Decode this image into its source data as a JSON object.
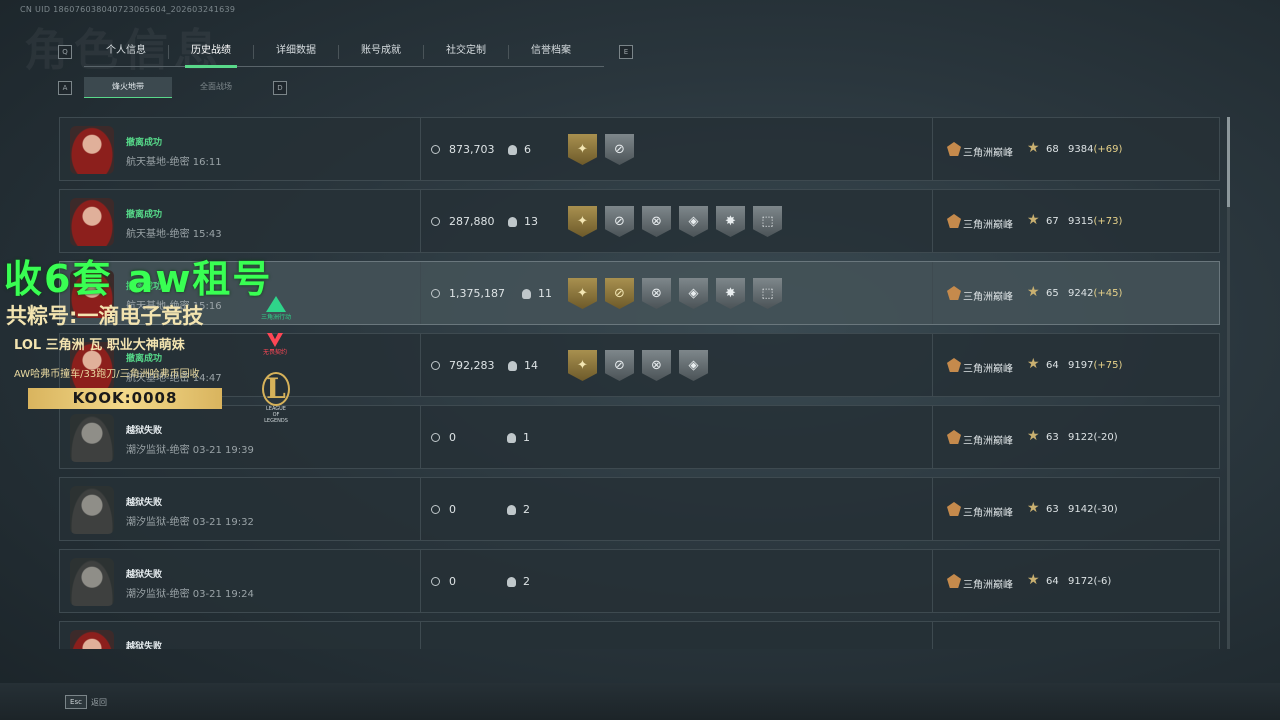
{
  "uid": "CN UID 1860760380407230656​04_202603241639",
  "bg_title": "角色信息",
  "key_hints": {
    "left_tab": "Q",
    "right_tab": "E",
    "left_sub": "A",
    "right_sub": "D"
  },
  "tabs": [
    {
      "label": "个人信息",
      "active": false
    },
    {
      "label": "历史战绩",
      "active": true
    },
    {
      "label": "详细数据",
      "active": false
    },
    {
      "label": "账号成就",
      "active": false
    },
    {
      "label": "社交定制",
      "active": false
    },
    {
      "label": "信誉档案",
      "active": false
    }
  ],
  "subtabs": [
    {
      "label": "烽火地带",
      "active": true
    },
    {
      "label": "全面战场",
      "active": false
    }
  ],
  "rows": [
    {
      "avatar": "female-operator",
      "status": "撤离成功",
      "status_type": "ok",
      "location": "航天基地-绝密 16:11",
      "value": "873,703",
      "kills": "6",
      "badges": [
        "gold",
        "grey"
      ],
      "rank_name": "三角洲巅峰",
      "level": "68",
      "score": "9384",
      "delta": "(+69)",
      "delta_type": "pos",
      "highlight": false
    },
    {
      "avatar": "female-operator",
      "status": "撤离成功",
      "status_type": "ok",
      "location": "航天基地-绝密 15:43",
      "value": "287,880",
      "kills": "13",
      "badges": [
        "gold",
        "grey",
        "grey",
        "grey",
        "grey",
        "grey"
      ],
      "rank_name": "三角洲巅峰",
      "level": "67",
      "score": "9315",
      "delta": "(+73)",
      "delta_type": "pos",
      "highlight": false
    },
    {
      "avatar": "female-operator",
      "status": "撤离成功",
      "status_type": "ok",
      "location": "航天基地-绝密 15:16",
      "value": "1,375,187",
      "kills": "11",
      "badges": [
        "gold",
        "gold",
        "grey",
        "grey",
        "grey",
        "grey"
      ],
      "rank_name": "三角洲巅峰",
      "level": "65",
      "score": "9242",
      "delta": "(+45)",
      "delta_type": "pos",
      "highlight": true
    },
    {
      "avatar": "female-operator",
      "status": "撤离成功",
      "status_type": "ok",
      "location": "航天基地-绝密 14:47",
      "value": "792,283",
      "kills": "14",
      "badges": [
        "gold",
        "grey",
        "grey",
        "grey"
      ],
      "rank_name": "三角洲巅峰",
      "level": "64",
      "score": "9197",
      "delta": "(+75)",
      "delta_type": "pos",
      "highlight": false
    },
    {
      "avatar": "male-operator",
      "status": "越狱失败",
      "status_type": "fail",
      "location": "潮汐监狱-绝密 03-21 19:39",
      "value": "0",
      "kills": "1",
      "badges": [],
      "rank_name": "三角洲巅峰",
      "level": "63",
      "score": "9122",
      "delta": "(-20)",
      "delta_type": "neg",
      "highlight": false
    },
    {
      "avatar": "male-operator",
      "status": "越狱失败",
      "status_type": "fail",
      "location": "潮汐监狱-绝密 03-21 19:32",
      "value": "0",
      "kills": "2",
      "badges": [],
      "rank_name": "三角洲巅峰",
      "level": "63",
      "score": "9142",
      "delta": "(-30)",
      "delta_type": "neg",
      "highlight": false
    },
    {
      "avatar": "male-operator",
      "status": "越狱失败",
      "status_type": "fail",
      "location": "潮汐监狱-绝密 03-21 19:24",
      "value": "0",
      "kills": "2",
      "badges": [],
      "rank_name": "三角洲巅峰",
      "level": "64",
      "score": "9172",
      "delta": "(-6)",
      "delta_type": "neg",
      "highlight": false
    },
    {
      "avatar": "female-operator",
      "status": "越狱失败",
      "status_type": "fail",
      "location": "",
      "value": "",
      "kills": "",
      "badges": [],
      "rank_name": "",
      "level": "",
      "score": "",
      "delta": "",
      "delta_type": "neg",
      "highlight": false
    }
  ],
  "footer": {
    "esc_key": "Esc",
    "back_label": "返回"
  },
  "ad_overlay": {
    "line1": "收6套 aw租号",
    "line2": "共粽号:一滴电子竞技",
    "line3": "LOL 三角洲 瓦 职业大神萌妹",
    "line4": "AW哈弗币撞车/33跑刀/三角洲哈弗币回收",
    "kook": "KOOK:0008",
    "logo1_caption": "三角洲行动",
    "logo2_caption": "无畏契约",
    "logo3_caption": "LEAGUE OF LEGENDS"
  },
  "colors": {
    "accent": "#59d98a",
    "success": "#56d889",
    "gold": "#c9b070",
    "ad_green": "#39ff53"
  }
}
